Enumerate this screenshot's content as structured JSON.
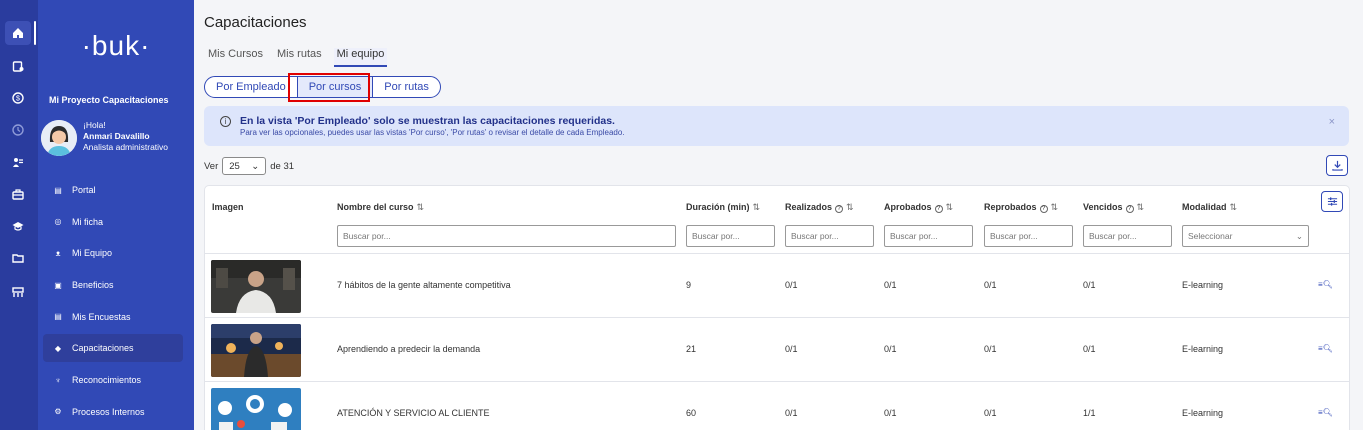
{
  "rail": {
    "items": [
      "home-icon",
      "courses-icon",
      "money-icon",
      "clock-icon",
      "people-icon",
      "briefcase-icon",
      "graduation-icon",
      "folder-icon",
      "grid-icon"
    ]
  },
  "sidebar": {
    "logo": "·buk·",
    "project": "Mi Proyecto Capacitaciones",
    "profile": {
      "greeting": "¡Hola!",
      "name": "Anmari Davalillo",
      "role": "Analista administrativo"
    },
    "items": [
      {
        "label": "Portal",
        "icon": "▤"
      },
      {
        "label": "Mi ficha",
        "icon": "◎"
      },
      {
        "label": "Mi Equipo",
        "icon": "ᴥ"
      },
      {
        "label": "Beneficios",
        "icon": "▣"
      },
      {
        "label": "Mis Encuestas",
        "icon": "▤"
      },
      {
        "label": "Capacitaciones",
        "icon": "◆"
      },
      {
        "label": "Reconocimientos",
        "icon": "♆"
      },
      {
        "label": "Procesos Internos",
        "icon": "⚙"
      }
    ]
  },
  "main": {
    "title": "Capacitaciones",
    "tabs": [
      "Mis Cursos",
      "Mis rutas",
      "Mi equipo"
    ],
    "views": [
      "Por Empleado",
      "Por cursos",
      "Por rutas"
    ],
    "alert": {
      "title": "En la vista 'Por Empleado' solo se muestran las capacitaciones requeridas.",
      "subtitle": "Para ver las opcionales, puedes usar las vistas 'Por curso', 'Por rutas' o revisar el detalle de cada Empleado.",
      "close": "×"
    },
    "pager": {
      "prefix": "Ver",
      "value": "25",
      "suffix": "de 31"
    },
    "table": {
      "headers": [
        "Imagen",
        "Nombre del curso",
        "Duración (min)",
        "Realizados",
        "Aprobados",
        "Reprobados",
        "Vencidos",
        "Modalidad"
      ],
      "filters": {
        "search": "Buscar por...",
        "search_short": "Buscar por...",
        "select": "Seleccionar"
      },
      "rows": [
        {
          "name": "7 hábitos de la gente altamente competitiva",
          "duracion": "9",
          "realizados": "0/1",
          "aprobados": "0/1",
          "reprobados": "0/1",
          "vencidos": "0/1",
          "modalidad": "E-learning"
        },
        {
          "name": "Aprendiendo a predecir la demanda",
          "duracion": "21",
          "realizados": "0/1",
          "aprobados": "0/1",
          "reprobados": "0/1",
          "vencidos": "0/1",
          "modalidad": "E-learning"
        },
        {
          "name": "ATENCIÓN Y SERVICIO AL CLIENTE",
          "duracion": "60",
          "realizados": "0/1",
          "aprobados": "0/1",
          "reprobados": "0/1",
          "vencidos": "1/1",
          "modalidad": "E-learning"
        }
      ]
    }
  },
  "colors": {
    "brand": "#3149b6",
    "rail": "#2a3c9e",
    "highlight": "#e00000",
    "alert_bg": "#dde5fb"
  }
}
